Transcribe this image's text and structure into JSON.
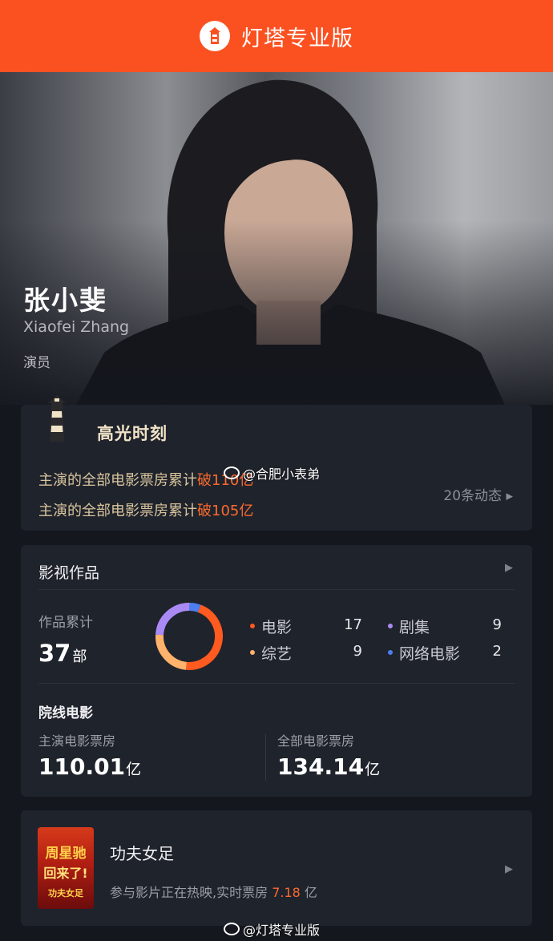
{
  "app": {
    "title": "灯塔专业版",
    "brand_color": "#fb5121",
    "icon": "lighthouse-logo-icon"
  },
  "profile": {
    "name": "张小斐",
    "english_name": "Xiaofei Zhang",
    "role": "演员"
  },
  "highlight": {
    "title": "高光时刻",
    "line1_prefix": "主演的全部电影票房累计",
    "line1_value": "破110亿",
    "line2_prefix": "主演的全部电影票房累计",
    "line2_value": "破105亿",
    "more_label": "20条动态 ▸"
  },
  "works": {
    "title": "影视作品",
    "arrow": "▶",
    "total_label": "作品累计",
    "total_value": "37",
    "total_unit": "部",
    "categories": [
      {
        "label": "电影",
        "value": "17",
        "color": "#ff5a1f"
      },
      {
        "label": "剧集",
        "value": "9",
        "color": "#a98af5"
      },
      {
        "label": "综艺",
        "value": "9",
        "color": "#ffb26b"
      },
      {
        "label": "网络电影",
        "value": "2",
        "color": "#4d7ef0"
      }
    ],
    "cinema_title": "院线电影",
    "lead_label": "主演电影票房",
    "lead_value": "110.01",
    "lead_unit": "亿",
    "all_label": "全部电影票房",
    "all_value": "134.14",
    "all_unit": "亿"
  },
  "film": {
    "title": "功夫女足",
    "desc_prefix": "参与影片正在热映,实时票房",
    "desc_value": "7.18",
    "desc_unit": "亿",
    "poster_line1": "周星驰",
    "poster_line2": "回来了!",
    "poster_line3": "功夫女足",
    "arrow": "▶"
  },
  "watermarks": {
    "top": "@合肥小表弟",
    "bottom": "@灯塔专业版"
  }
}
